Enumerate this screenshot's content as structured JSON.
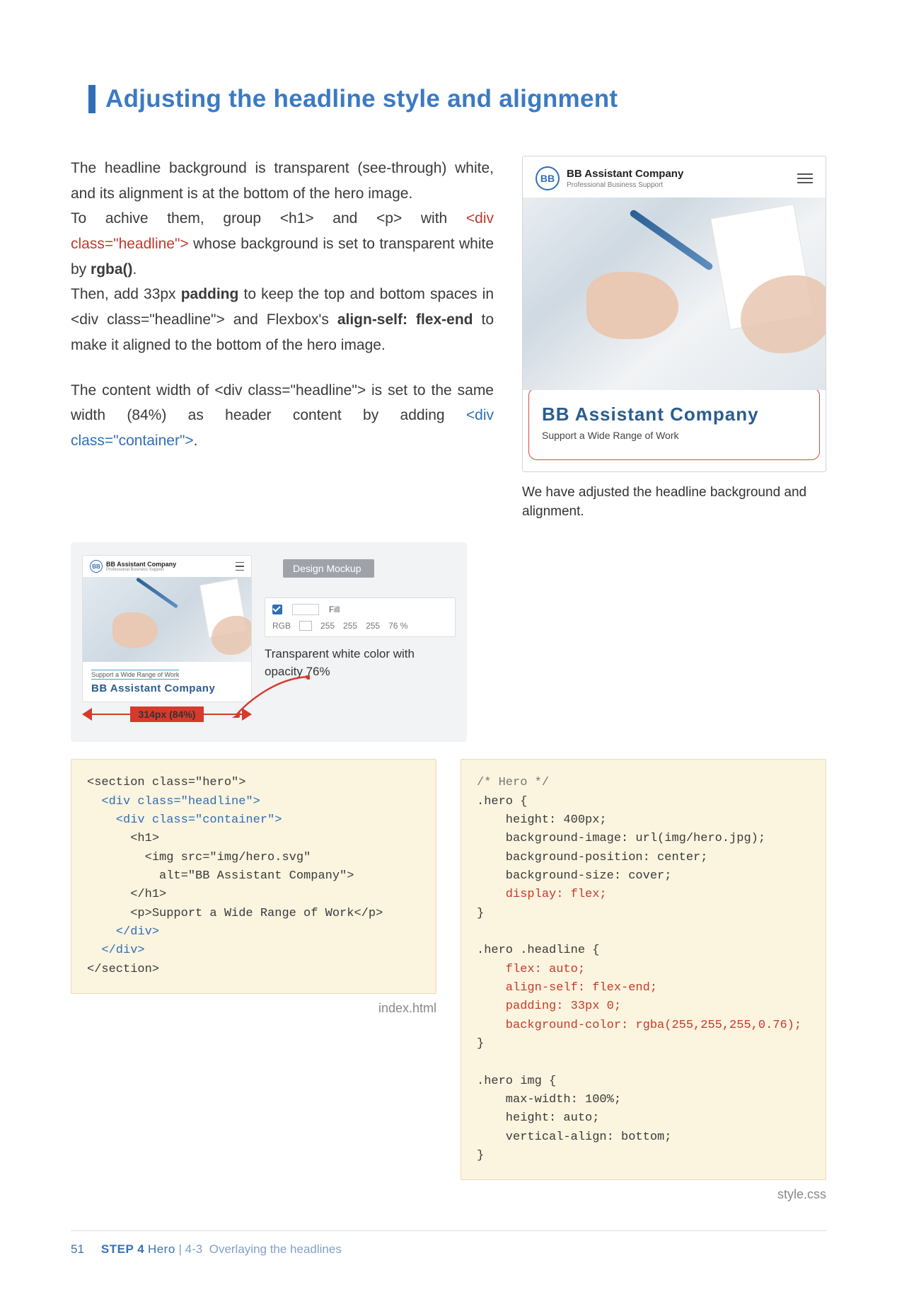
{
  "heading": {
    "title": "Adjusting the headline style and alignment"
  },
  "article": {
    "p1a": "The headline background is transparent (see-through) white, and its alignment is at the bottom of the hero image.",
    "p1b_pre": "To achive them, group <h1> and <p> with ",
    "p1b_code": "<div class=\"headline\">",
    "p1b_post": " whose background is set to transparent white by ",
    "p1b_bold": "rgba()",
    "p1b_dot": ".",
    "p2a": "Then, add 33px ",
    "p2a_bold": "padding",
    "p2b": " to keep the top and bottom spaces in <div class=\"headline\"> and Flexbox's ",
    "p2b_bold": "align-self: flex-end",
    "p2c": " to make it aligned to the bottom of the hero image.",
    "p3a": "The content width of <div class=\"headline\"> is set to the same width (84%) as header content by adding ",
    "p3_code": "<div class=\"container\">",
    "p3_dot": "."
  },
  "mockup": {
    "brand_title": "BB Assistant Company",
    "brand_sub": "Professional Business Support",
    "headline_big": "BB Assistant Company",
    "headline_sub": "Support a Wide Range of Work",
    "caption": "We have adjusted the headline background and alignment."
  },
  "design_panel": {
    "badge": "Design Mockup",
    "mini_sub": "Support a Wide Range of Work",
    "mini_big": "BB Assistant Company",
    "width_label": "314px (84%)",
    "fill_label": "Fill",
    "mode": "RGB",
    "r": "255",
    "g": "255",
    "b": "255",
    "a": "76 %",
    "trans_label": "Transparent white color with opacity 76%"
  },
  "code_html": {
    "l1": "<section class=\"hero\">",
    "l2": "  <div class=\"headline\">",
    "l3": "    <div class=\"container\">",
    "l4": "      <h1>",
    "l5": "        <img src=\"img/hero.svg\"",
    "l6": "          alt=\"BB Assistant Company\">",
    "l7": "      </h1>",
    "l8": "      <p>Support a Wide Range of Work</p>",
    "l9": "    </div>",
    "l10": "  </div>",
    "l11": "</section>",
    "filename": "index.html"
  },
  "code_css": {
    "l1": "/* Hero */",
    "l2": ".hero {",
    "l3": "    height: 400px;",
    "l4": "    background-image: url(img/hero.jpg);",
    "l5": "    background-position: center;",
    "l6": "    background-size: cover;",
    "l7_red": "    display: flex;",
    "l8": "}",
    "bl": " ",
    "h2": ".hero .headline {",
    "h3_red1": "    flex: auto;",
    "h3_red2": "    align-self: flex-end;",
    "h3_red3": "    padding: 33px 0;",
    "h3_red4": "    background-color: rgba(255,255,255,0.76);",
    "h4": "}",
    "i1": ".hero img {",
    "i2": "    max-width: 100%;",
    "i3": "    height: auto;",
    "i4": "    vertical-align: bottom;",
    "i5": "}",
    "filename": "style.css"
  },
  "footer": {
    "page": "51",
    "step": "STEP 4",
    "step_title": "Hero",
    "divider": "  |  ",
    "section": "4-3",
    "section_title": "Overlaying the headlines"
  }
}
